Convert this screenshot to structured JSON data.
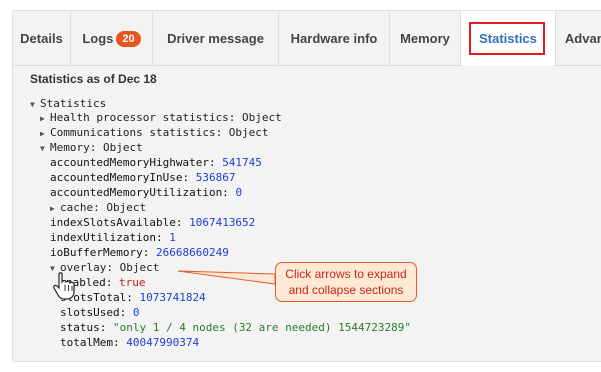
{
  "tabs": {
    "details": "Details",
    "logs": "Logs",
    "logs_count": "20",
    "driver_message": "Driver message",
    "hardware_info": "Hardware info",
    "memory": "Memory",
    "statistics": "Statistics",
    "advanced": "Advanced",
    "active": "Statistics"
  },
  "content": {
    "heading": "Statistics as of Dec 18"
  },
  "tree": {
    "root": "Statistics",
    "health": "Health processor statistics: Object",
    "comms": "Communications statistics: Object",
    "memory": "Memory: Object",
    "k_highwater": "accountedMemoryHighwater: ",
    "v_highwater": "541745",
    "k_inuse": "accountedMemoryInUse: ",
    "v_inuse": "536867",
    "k_util": "accountedMemoryUtilization: ",
    "v_util": "0",
    "cache": "cache: Object",
    "k_slots": "indexSlotsAvailable: ",
    "v_slots": "1067413652",
    "k_idxutil": "indexUtilization: ",
    "v_idxutil": "1",
    "k_iobuf": "ioBufferMemory: ",
    "v_iobuf": "26668660249",
    "overlay": "overlay: Object",
    "k_enabled": "nabled: ",
    "v_enabled": "true",
    "k_slotstotal": "slotsTotal: ",
    "v_slotstotal": "1073741824",
    "k_slotsused": "slotsUsed: ",
    "v_slotsused": "0",
    "k_status": "status: ",
    "v_status": "\"only 1 / 4 nodes (32 are needed) 1544723289\"",
    "k_totalmem": "totalMem: ",
    "v_totalmem": "40047990374"
  },
  "callout": {
    "line1": "Click arrows to expand",
    "line2": "and collapse sections"
  },
  "colors": {
    "accent": "#2f6fba",
    "highlight": "#e21c1c",
    "badge": "#e8551c",
    "callout_bg": "#ffe8d4",
    "callout_text": "#c4271b",
    "number": "#1d3fd6",
    "boolean": "#c41a16",
    "string": "#2a7d2a"
  },
  "icons": {
    "expanded": "triangle-down-icon",
    "collapsed": "triangle-right-icon",
    "cursor": "hand-pointer-icon"
  }
}
